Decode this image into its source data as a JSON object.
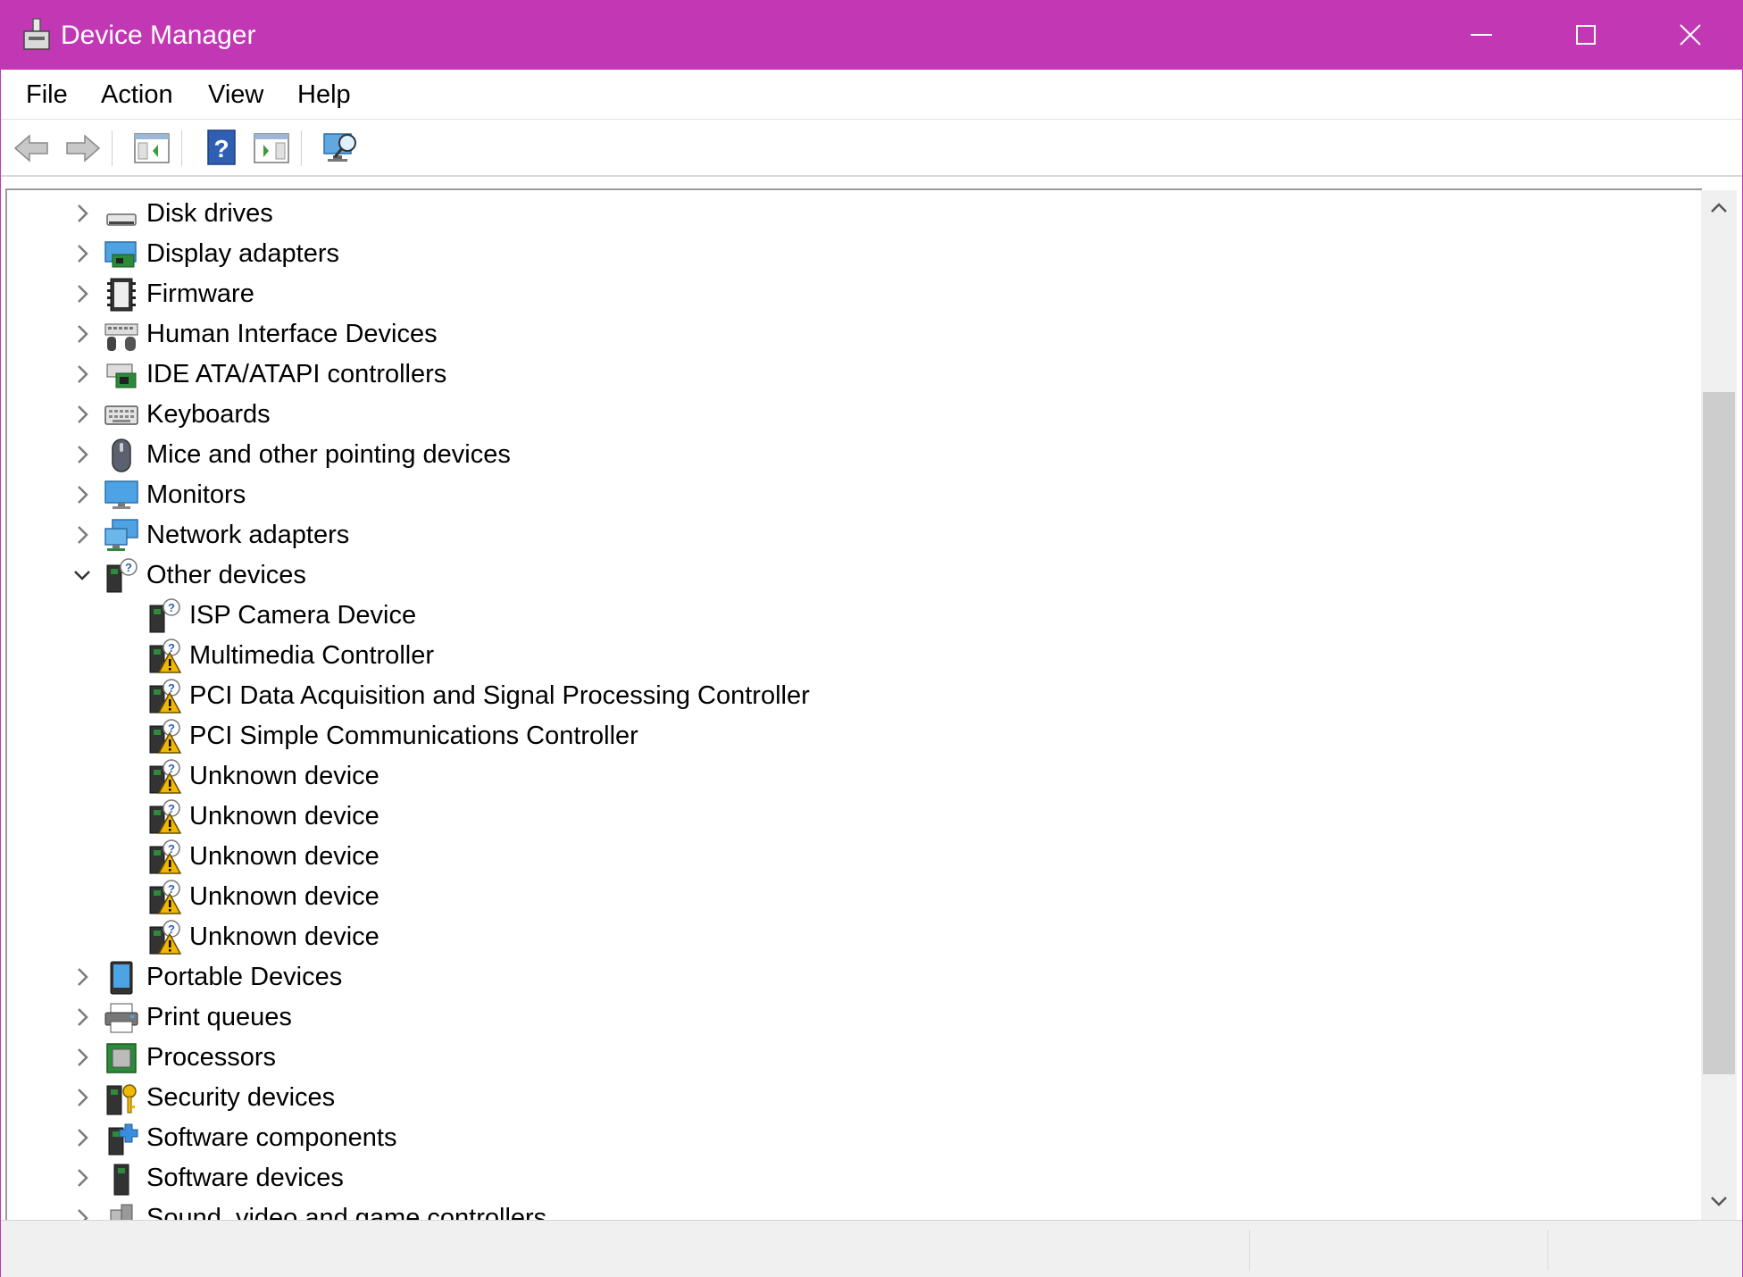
{
  "window": {
    "title": "Device Manager",
    "accent_color": "#c238b4",
    "controls": {
      "minimize": "minimize-icon",
      "maximize": "maximize-icon",
      "close": "close-icon"
    }
  },
  "menu": [
    "File",
    "Action",
    "View",
    "Help"
  ],
  "toolbar": [
    "back-arrow-icon",
    "forward-arrow-icon",
    "show-hide-console-tree-icon",
    "help-icon",
    "show-hide-action-pane-icon",
    "scan-hardware-icon"
  ],
  "tree": {
    "categories_before": [
      {
        "label": "Disk drives",
        "icon": "disk-drive-icon"
      },
      {
        "label": "Display adapters",
        "icon": "display-adapter-icon"
      },
      {
        "label": "Firmware",
        "icon": "firmware-icon"
      },
      {
        "label": "Human Interface Devices",
        "icon": "hid-icon"
      },
      {
        "label": "IDE ATA/ATAPI controllers",
        "icon": "ide-controller-icon"
      },
      {
        "label": "Keyboards",
        "icon": "keyboard-icon"
      },
      {
        "label": "Mice and other pointing devices",
        "icon": "mouse-icon"
      },
      {
        "label": "Monitors",
        "icon": "monitor-icon"
      },
      {
        "label": "Network adapters",
        "icon": "network-adapter-icon"
      }
    ],
    "expanded": {
      "label": "Other devices",
      "icon": "other-devices-icon",
      "children": [
        {
          "label": "ISP Camera Device",
          "icon": "unknown-device-icon",
          "warning": false
        },
        {
          "label": "Multimedia Controller",
          "icon": "unknown-device-warning-icon",
          "warning": true
        },
        {
          "label": "PCI Data Acquisition and Signal Processing Controller",
          "icon": "unknown-device-warning-icon",
          "warning": true
        },
        {
          "label": "PCI Simple Communications Controller",
          "icon": "unknown-device-warning-icon",
          "warning": true
        },
        {
          "label": "Unknown device",
          "icon": "unknown-device-warning-icon",
          "warning": true
        },
        {
          "label": "Unknown device",
          "icon": "unknown-device-warning-icon",
          "warning": true
        },
        {
          "label": "Unknown device",
          "icon": "unknown-device-warning-icon",
          "warning": true
        },
        {
          "label": "Unknown device",
          "icon": "unknown-device-warning-icon",
          "warning": true
        },
        {
          "label": "Unknown device",
          "icon": "unknown-device-warning-icon",
          "warning": true
        }
      ]
    },
    "categories_after": [
      {
        "label": "Portable Devices",
        "icon": "portable-device-icon"
      },
      {
        "label": "Print queues",
        "icon": "printer-icon"
      },
      {
        "label": "Processors",
        "icon": "processor-icon"
      },
      {
        "label": "Security devices",
        "icon": "security-device-icon"
      },
      {
        "label": "Software components",
        "icon": "software-component-icon"
      },
      {
        "label": "Software devices",
        "icon": "software-device-icon"
      },
      {
        "label": "Sound, video and game controllers",
        "icon": "sound-icon"
      }
    ]
  }
}
